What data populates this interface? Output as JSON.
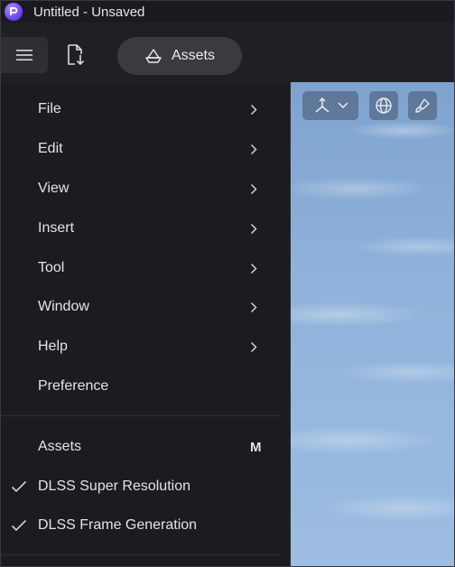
{
  "window": {
    "title": "Untitled - Unsaved"
  },
  "toolbar": {
    "assets_label": "Assets"
  },
  "menu": {
    "items": [
      {
        "label": "File",
        "icon": "chevron-right-icon"
      },
      {
        "label": "Edit",
        "icon": "chevron-right-icon"
      },
      {
        "label": "View",
        "icon": "chevron-right-icon"
      },
      {
        "label": "Insert",
        "icon": "chevron-right-icon"
      },
      {
        "label": "Tool",
        "icon": "chevron-right-icon"
      },
      {
        "label": "Window",
        "icon": "chevron-right-icon"
      },
      {
        "label": "Help",
        "icon": "chevron-right-icon"
      },
      {
        "label": "Preference"
      }
    ],
    "toggles": [
      {
        "label": "Assets",
        "shortcut": "M",
        "checked": false
      },
      {
        "label": "DLSS Super Resolution",
        "checked": true
      },
      {
        "label": "DLSS Frame Generation",
        "checked": true
      }
    ]
  },
  "icons": {
    "app_logo": "app-logo-icon",
    "menu": "hamburger-icon",
    "export": "export-file-icon",
    "assets": "assets-boat-icon",
    "axis": "axis-gizmo-icon",
    "globe": "globe-icon",
    "brush": "brush-icon"
  },
  "colors": {
    "accent": "#6a3df0",
    "panel": "#1b1c21",
    "text": "#e4e4e8"
  }
}
